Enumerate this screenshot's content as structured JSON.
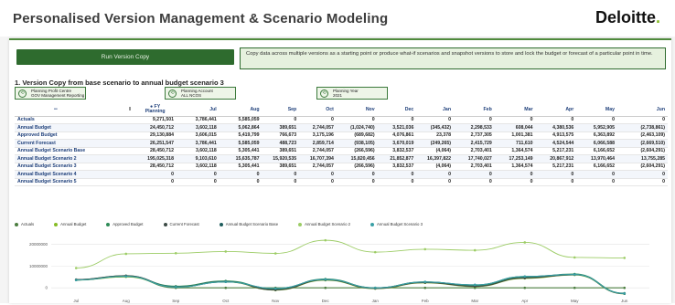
{
  "header": {
    "title": "Personalised Version Management & Scenario Modeling",
    "logo_text": "Deloitte",
    "logo_dot": "."
  },
  "run_button_label": "Run Version Copy",
  "description": "Copy data across multiple versions as a starting point or produce what-if scenarios and snapshot versions to store and lock the budget or forecast of a particular point in time.",
  "section_title": "1. Version Copy from base scenario to annual budget scenario 3",
  "filters": [
    {
      "label": "Planning Profit Centre",
      "value": "GOV Management Reporting"
    },
    {
      "label": "Planning Account",
      "value": "ALL NCOS"
    },
    {
      "label": "Planning Year",
      "value": "2021"
    }
  ],
  "table": {
    "fy_header": [
      "FY",
      "Planning"
    ],
    "months": [
      "Jul",
      "Aug",
      "Sep",
      "Oct",
      "Nov",
      "Dec",
      "Jan",
      "Feb",
      "Mar",
      "Apr",
      "May",
      "Jun"
    ],
    "rows": [
      {
        "name": "Actuals",
        "values": [
          "9,271,501",
          "3,786,441",
          "5,585,059",
          "0",
          "0",
          "0",
          "0",
          "0",
          "0",
          "0",
          "0",
          "0",
          "0"
        ]
      },
      {
        "name": "Annual Budget",
        "values": [
          "24,450,712",
          "3,602,118",
          "5,062,864",
          "389,651",
          "2,744,057",
          "(1,024,740)",
          "3,521,036",
          "(345,432)",
          "2,298,533",
          "608,044",
          "4,380,536",
          "5,952,905",
          "(2,738,861)"
        ]
      },
      {
        "name": "Approved Budget",
        "values": [
          "29,130,884",
          "3,606,015",
          "5,419,799",
          "766,673",
          "3,175,196",
          "(689,682)",
          "4,076,861",
          "23,378",
          "2,737,305",
          "1,001,381",
          "4,913,575",
          "6,363,892",
          "(2,463,109)"
        ]
      },
      {
        "name": "Current Forecast",
        "values": [
          "26,251,547",
          "3,786,441",
          "5,585,059",
          "488,723",
          "2,859,714",
          "(938,105)",
          "3,670,019",
          "(249,265)",
          "2,415,729",
          "711,610",
          "4,524,544",
          "6,066,588",
          "(2,669,510)"
        ]
      },
      {
        "name": "Annual Budget Scenario Base",
        "values": [
          "28,450,712",
          "3,602,118",
          "5,305,441",
          "389,651",
          "2,744,057",
          "(266,596)",
          "3,832,537",
          "(4,064)",
          "2,703,401",
          "1,364,574",
          "5,217,231",
          "6,166,652",
          "(2,604,291)"
        ]
      },
      {
        "name": "Annual Budget Scenario 2",
        "values": [
          "195,025,318",
          "9,103,610",
          "15,635,787",
          "15,920,535",
          "16,707,394",
          "15,820,456",
          "21,852,877",
          "16,397,822",
          "17,740,027",
          "17,253,149",
          "20,867,912",
          "13,970,464",
          "13,755,285"
        ]
      },
      {
        "name": "Annual Budget Scenario 3",
        "values": [
          "28,450,712",
          "3,602,118",
          "5,305,441",
          "389,651",
          "2,744,057",
          "(266,596)",
          "3,832,537",
          "(4,064)",
          "2,703,401",
          "1,364,574",
          "5,217,231",
          "6,166,652",
          "(2,604,291)"
        ]
      },
      {
        "name": "Annual Budget Scenario 4",
        "values": [
          "0",
          "0",
          "0",
          "0",
          "0",
          "0",
          "0",
          "0",
          "0",
          "0",
          "0",
          "0",
          "0"
        ]
      },
      {
        "name": "Annual Budget Scenario 5",
        "values": [
          "0",
          "0",
          "0",
          "0",
          "0",
          "0",
          "0",
          "0",
          "0",
          "0",
          "0",
          "0",
          "0"
        ]
      }
    ]
  },
  "chart_data": {
    "type": "line",
    "categories": [
      "Jul",
      "Aug",
      "Sep",
      "Oct",
      "Nov",
      "Dec",
      "Jan",
      "Feb",
      "Mar",
      "Apr",
      "May",
      "Jun"
    ],
    "yticks": [
      "20000000",
      "10000000",
      "0"
    ],
    "ylim": [
      -2000000,
      24000000
    ],
    "series": [
      {
        "name": "Actuals",
        "color": "#4b7d3f",
        "values": [
          3786441,
          5585059,
          0,
          0,
          0,
          0,
          0,
          0,
          0,
          0,
          0,
          0
        ]
      },
      {
        "name": "Annual Budget",
        "color": "#86bc25",
        "values": [
          3602118,
          5062864,
          389651,
          2744057,
          -1024740,
          3521036,
          -345432,
          2298533,
          608044,
          4380536,
          5952905,
          -2738861
        ]
      },
      {
        "name": "Approved Budget",
        "color": "#2e8b57",
        "values": [
          3606015,
          5419799,
          766673,
          3175196,
          -689682,
          4076861,
          23378,
          2737305,
          1001381,
          4913575,
          6363892,
          -2463109
        ]
      },
      {
        "name": "Current Forecast",
        "color": "#3c4a44",
        "values": [
          3786441,
          5585059,
          488723,
          2859714,
          -938105,
          3670019,
          -249265,
          2415729,
          711610,
          4524544,
          6066588,
          -2669510
        ]
      },
      {
        "name": "Annual Budget Scenario Base",
        "color": "#1e5c5c",
        "values": [
          3602118,
          5305441,
          389651,
          2744057,
          -266596,
          3832537,
          -4064,
          2703401,
          1364574,
          5217231,
          6166652,
          -2604291
        ]
      },
      {
        "name": "Annual Budget Scenario 2",
        "color": "#9ccc65",
        "values": [
          9103610,
          15635787,
          15920535,
          16707394,
          15820456,
          21852877,
          16397822,
          17740027,
          17253149,
          20867912,
          13970464,
          13755285
        ]
      },
      {
        "name": "Annual Budget Scenario 3",
        "color": "#3aa0a6",
        "values": [
          3602118,
          5305441,
          389651,
          2744057,
          -266596,
          3832537,
          -4064,
          2703401,
          1364574,
          5217231,
          6166652,
          -2604291
        ]
      }
    ]
  }
}
